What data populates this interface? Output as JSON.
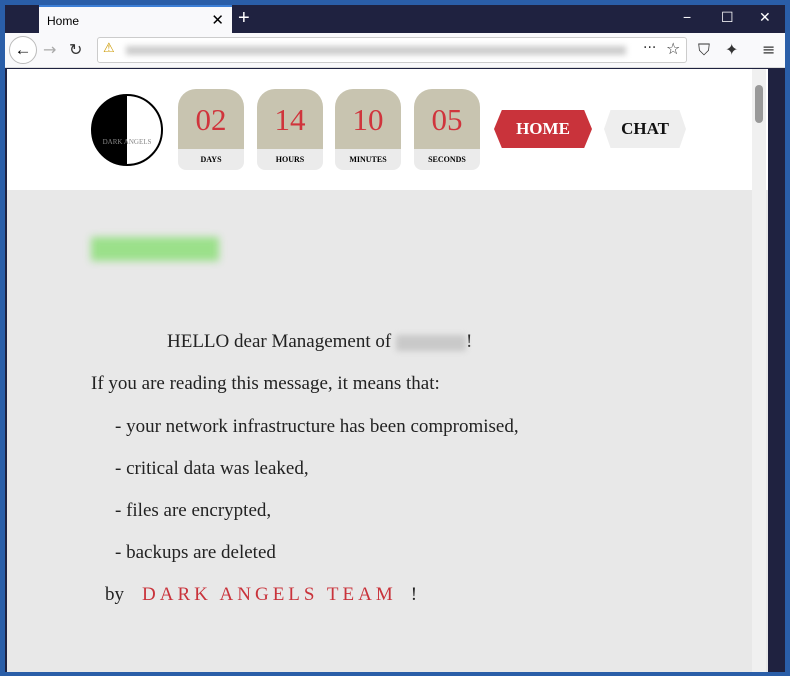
{
  "browser": {
    "tab_title": "Home",
    "new_tab": "+",
    "close": "✕",
    "minimize": "−",
    "maximize": "☐",
    "window_close": "✕"
  },
  "header": {
    "logo_text": "DARK ANGELS",
    "countdown": [
      {
        "value": "02",
        "label": "DAYS"
      },
      {
        "value": "14",
        "label": "HOURS"
      },
      {
        "value": "10",
        "label": "MINUTES"
      },
      {
        "value": "05",
        "label": "SECONDS"
      }
    ],
    "nav": {
      "home": "HOME",
      "chat": "CHAT"
    }
  },
  "message": {
    "greeting_prefix": "HELLO dear Management of ",
    "greeting_suffix": "!",
    "intro": "If you are reading this message, it means that:",
    "items": [
      "- your network infrastructure has been compromised,",
      "- critical data was leaked,",
      "- files are encrypted,",
      "- backups are deleted"
    ],
    "by": "by",
    "team": "DARK ANGELS TEAM",
    "exclaim": "!"
  },
  "colors": {
    "accent": "#c9333b",
    "countdown_bg": "#c8c4b0",
    "frame": "#1f2240"
  }
}
